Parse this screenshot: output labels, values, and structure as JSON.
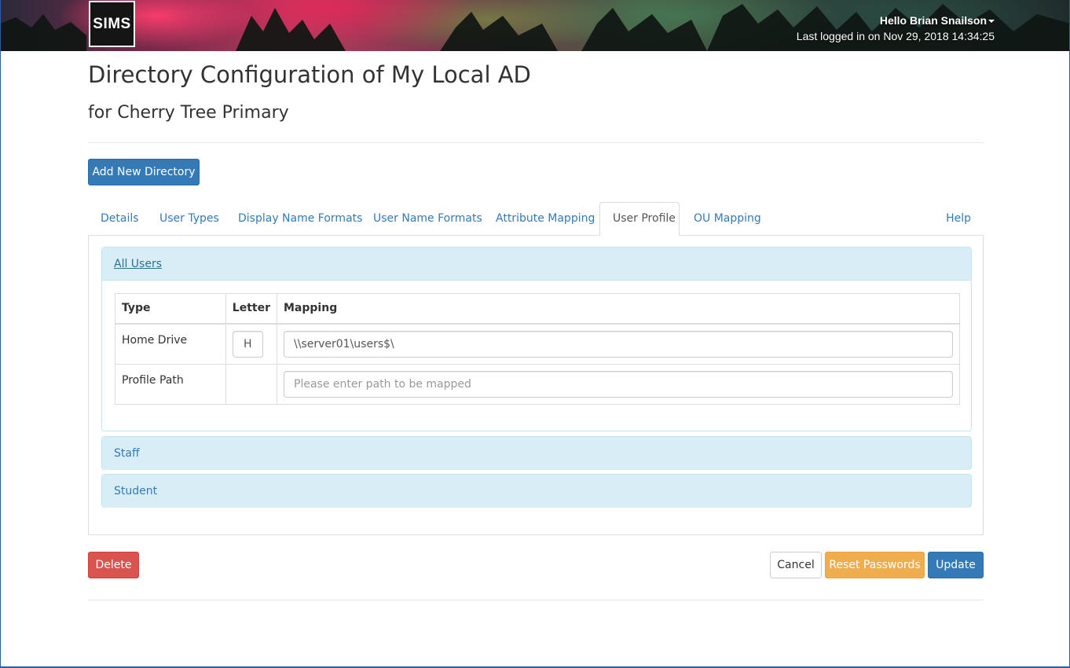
{
  "header": {
    "logo_text": "SIMS",
    "greeting": "Hello Brian Snailson",
    "last_login": "Last logged in on Nov 29, 2018 14:34:25"
  },
  "page": {
    "title": "Directory Configuration of My Local AD",
    "subtitle": "for Cherry Tree Primary",
    "add_button": "Add New Directory"
  },
  "tabs": [
    {
      "label": "Details",
      "active": false
    },
    {
      "label": "User Types",
      "active": false
    },
    {
      "label": "Display Name Formats",
      "active": false
    },
    {
      "label": "User Name Formats",
      "active": false
    },
    {
      "label": "Attribute Mapping",
      "active": false
    },
    {
      "label": "User Profile",
      "active": true
    },
    {
      "label": "OU Mapping",
      "active": false
    },
    {
      "label": "Help",
      "active": false
    }
  ],
  "panels": {
    "all_users": {
      "title": "All Users",
      "table": {
        "headers": [
          "Type",
          "Letter",
          "Mapping"
        ],
        "rows": [
          {
            "type": "Home Drive",
            "letter": "H",
            "mapping": "\\\\server01\\users$\\",
            "mapping_placeholder": ""
          },
          {
            "type": "Profile Path",
            "letter": "",
            "mapping": "",
            "mapping_placeholder": "Please enter path to be mapped"
          }
        ]
      }
    },
    "staff": {
      "title": "Staff"
    },
    "student": {
      "title": "Student"
    }
  },
  "actions": {
    "delete": "Delete",
    "cancel": "Cancel",
    "reset_passwords": "Reset Passwords",
    "update": "Update"
  },
  "colors": {
    "primary": "#337ab7",
    "danger": "#d9534f",
    "warning": "#f0ad4e",
    "panel_info_bg": "#d9edf7"
  }
}
